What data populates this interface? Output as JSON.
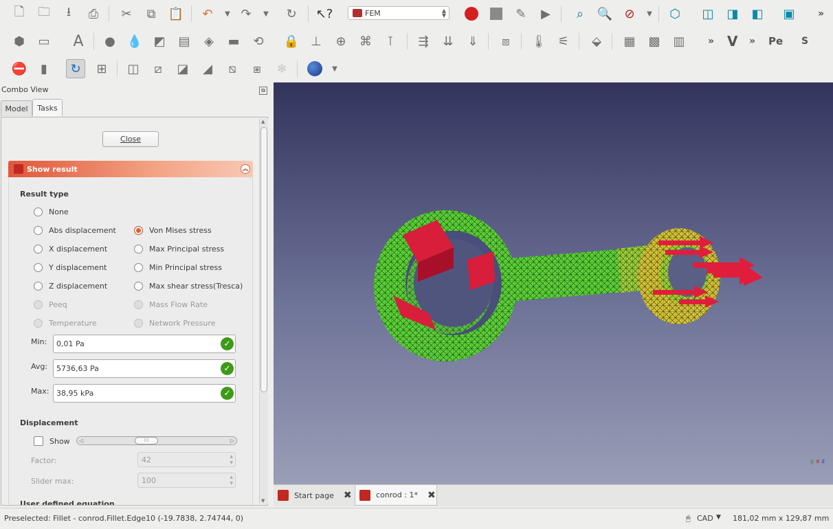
{
  "toolbar": {
    "workbench": "FEM",
    "overflow_symbol": "»",
    "workbench_buttons": [
      "V",
      "Pe",
      "S"
    ]
  },
  "combo_view": {
    "title": "Combo View",
    "tabs": [
      {
        "label": "Model"
      },
      {
        "label": "Tasks"
      }
    ]
  },
  "tasks": {
    "close_label": "Close",
    "panel_title": "Show result",
    "result_type_title": "Result type",
    "options": [
      {
        "label": "None",
        "checked": false,
        "enabled": true
      },
      {
        "label": "Abs displacement",
        "checked": false,
        "enabled": true
      },
      {
        "label": "Von Mises stress",
        "checked": true,
        "enabled": true
      },
      {
        "label": "X displacement",
        "checked": false,
        "enabled": true
      },
      {
        "label": "Max Principal stress",
        "checked": false,
        "enabled": true
      },
      {
        "label": "Y displacement",
        "checked": false,
        "enabled": true
      },
      {
        "label": "Min Principal stress",
        "checked": false,
        "enabled": true
      },
      {
        "label": "Z displacement",
        "checked": false,
        "enabled": true
      },
      {
        "label": "Max shear stress(Tresca)",
        "checked": false,
        "enabled": true
      },
      {
        "label": "Peeq",
        "checked": false,
        "enabled": false
      },
      {
        "label": "Mass Flow Rate",
        "checked": false,
        "enabled": false
      },
      {
        "label": "Temperature",
        "checked": false,
        "enabled": false
      },
      {
        "label": "Network Pressure",
        "checked": false,
        "enabled": false
      }
    ],
    "min_label": "Min:",
    "min_value": "0,01 Pa",
    "avg_label": "Avg:",
    "avg_value": "5736,63 Pa",
    "max_label": "Max:",
    "max_value": "38,95 kPa",
    "displacement_title": "Displacement",
    "show_label": "Show",
    "factor_label": "Factor:",
    "factor_value": "42",
    "slider_max_label": "Slider max:",
    "slider_max_value": "100",
    "cut_off_text": "User defined equation"
  },
  "view": {
    "background_top": "#33345e",
    "background_bottom": "#9a9eb6",
    "mesh_color": "#5fd43a",
    "constraint_color": "#d81e3a",
    "axis_labels": [
      "x",
      "y",
      "z"
    ]
  },
  "document_tabs": [
    {
      "label": "Start page",
      "active": false
    },
    {
      "label": "conrod : 1*",
      "active": true
    }
  ],
  "status": {
    "preselected": "Preselected: Fillet - conrod.Fillet.Edge10 (-19.7838, 2.74744, 0)",
    "nav_style": "CAD",
    "dimensions": "181,02 mm x 129,87 mm"
  }
}
